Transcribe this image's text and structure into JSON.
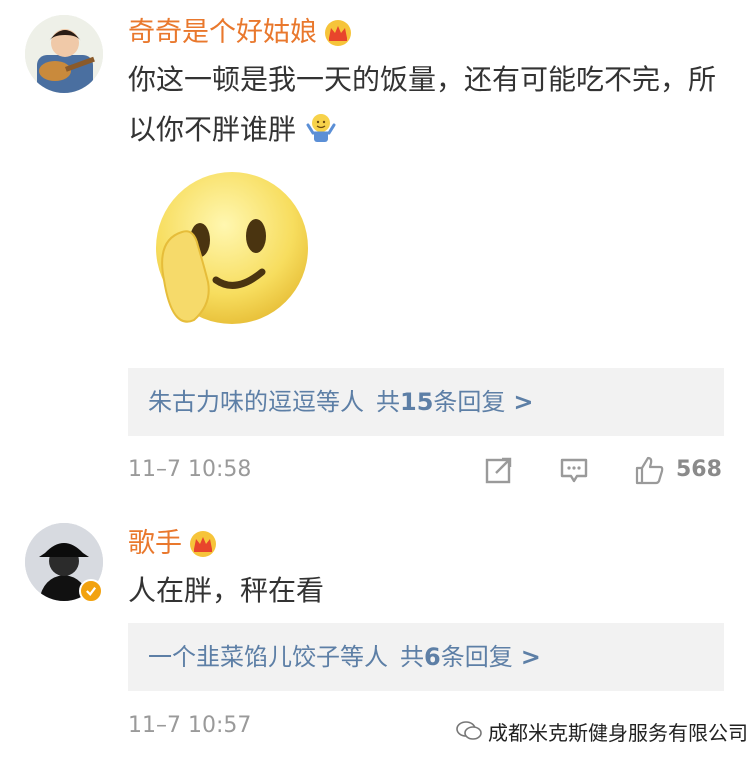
{
  "comments": [
    {
      "username": "奇奇是个好姑娘",
      "text": "你这一顿是我一天的饭量，还有可能吃不完，所以你不胖谁胖",
      "replies": {
        "names": "朱古力味的逗逗",
        "suffix": "等人",
        "count_prefix": "共",
        "count": "15",
        "count_suffix": "条回复",
        "chevron": ">"
      },
      "time": "11–7 10:58",
      "like_count": "568"
    },
    {
      "username": "歌手",
      "text": "人在胖，秤在看",
      "replies": {
        "names": "一个韭菜馅儿饺子",
        "suffix": "等人",
        "count_prefix": "共",
        "count": "6",
        "count_suffix": "条回复",
        "chevron": ">"
      },
      "time": "11–7 10:57"
    }
  ],
  "watermark": {
    "text": "成都米克斯健身服务有限公司"
  },
  "colors": {
    "username": "#e9782d",
    "link": "#5d7fa6",
    "meta": "#9a9a9a",
    "reply_bg": "#f2f2f2"
  },
  "icons": [
    "crown-badge-icon",
    "shrug-emoji-icon",
    "smirk-emoji-icon",
    "share-icon",
    "reply-icon",
    "like-icon",
    "verified-badge-icon",
    "wechat-logo-icon"
  ]
}
